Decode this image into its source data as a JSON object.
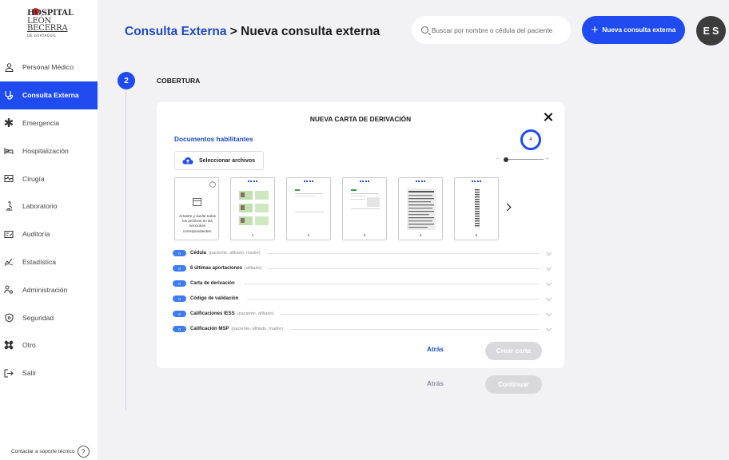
{
  "app": {
    "logo": {
      "line1": "HOSPITAL",
      "line2": "LEÓN",
      "line3": "BECERRA",
      "line4": "DE GUAYAQUIL"
    }
  },
  "sidebar": {
    "items": [
      {
        "label": "Personal Médico",
        "icon": "doctor-icon",
        "active": false
      },
      {
        "label": "Consulta Externa",
        "icon": "stethoscope-icon",
        "active": true
      },
      {
        "label": "Emergencia",
        "icon": "asterisk-icon",
        "active": false
      },
      {
        "label": "Hospitalización",
        "icon": "bed-icon",
        "active": false
      },
      {
        "label": "Cirugía",
        "icon": "surgery-icon",
        "active": false
      },
      {
        "label": "Laboratorio",
        "icon": "microscope-icon",
        "active": false
      },
      {
        "label": "Auditoría",
        "icon": "audit-icon",
        "active": false
      },
      {
        "label": "Estadística",
        "icon": "chart-icon",
        "active": false
      },
      {
        "label": "Administración",
        "icon": "admin-icon",
        "active": false
      },
      {
        "label": "Seguridad",
        "icon": "shield-icon",
        "active": false
      },
      {
        "label": "Otro",
        "icon": "bandage-icon",
        "active": false
      },
      {
        "label": "Salir",
        "icon": "logout-icon",
        "active": false
      }
    ],
    "support_label": "Contactar a soporte técnico"
  },
  "header": {
    "breadcrumb_link": "Consulta Externa",
    "breadcrumb_sep": ">",
    "breadcrumb_current": "Nueva consulta externa",
    "search_placeholder": "Buscar por nombre o cédula del paciente",
    "new_button": "Nueva consulta externa",
    "avatar_initials": "ES"
  },
  "step": {
    "number": "2",
    "label": "COBERTURA"
  },
  "modal": {
    "title": "NUEVA CARTA DE DERIVACIÓN",
    "docs_title": "Documentos habilitantes",
    "zoom_value": "4",
    "upload_label": "Seleccionar archivos",
    "dropzone_text": "Arrastre y suelte todos los archivos en las secciones correspondientes.",
    "pages": [
      "1",
      "2",
      "3",
      "4",
      "5"
    ],
    "sections": [
      {
        "count": "0",
        "name": "Cédula",
        "sub": "(paciente, afiliado, madre)"
      },
      {
        "count": "0",
        "name": "6 últimas aportaciones",
        "sub": "(afiliado)"
      },
      {
        "count": "0",
        "name": "Carta de derivación",
        "sub": ""
      },
      {
        "count": "0",
        "name": "Código de validación",
        "sub": ""
      },
      {
        "count": "0",
        "name": "Calificaciones IESS",
        "sub": "(paciente, afiliado)"
      },
      {
        "count": "0",
        "name": "Calificación MSP",
        "sub": "(paciente, afiliado, madre)"
      }
    ],
    "back_label": "Atrás",
    "create_label": "Crear carta"
  },
  "footer": {
    "back_label": "Atrás",
    "continue_label": "Continuar"
  },
  "colors": {
    "primary": "#1f4bf0",
    "link": "#1f4bbf",
    "badge": "#3f7cf2",
    "disabled": "#d9d9db"
  }
}
